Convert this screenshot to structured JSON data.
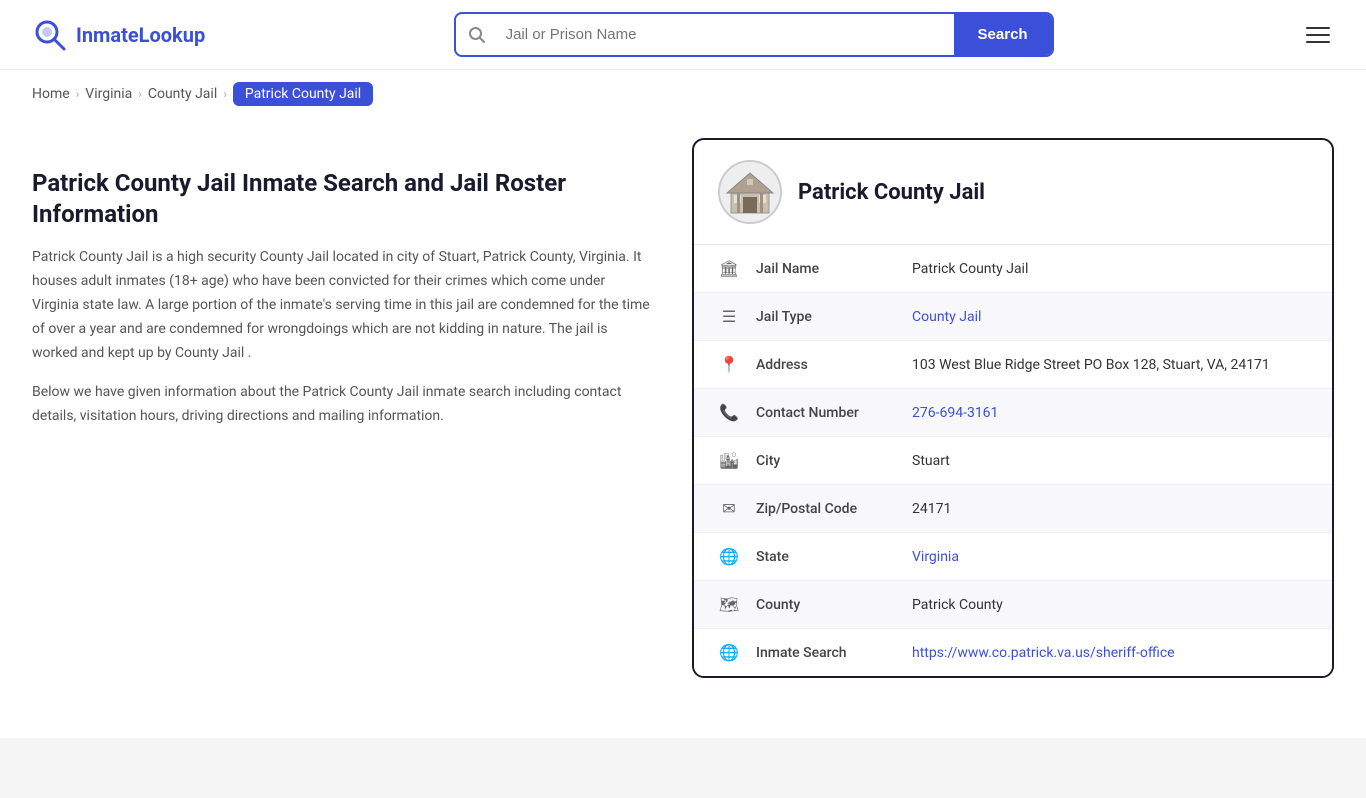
{
  "header": {
    "logo_text_main": "Inmate",
    "logo_text_accent": "Lookup",
    "search_placeholder": "Jail or Prison Name",
    "search_button_label": "Search"
  },
  "breadcrumb": {
    "items": [
      {
        "label": "Home",
        "href": "#"
      },
      {
        "label": "Virginia",
        "href": "#"
      },
      {
        "label": "County Jail",
        "href": "#"
      },
      {
        "label": "Patrick County Jail",
        "active": true
      }
    ]
  },
  "left": {
    "title": "Patrick County Jail Inmate Search and Jail Roster Information",
    "desc1": "Patrick County Jail is a high security County Jail located in city of Stuart, Patrick County, Virginia. It houses adult inmates (18+ age) who have been convicted for their crimes which come under Virginia state law. A large portion of the inmate's serving time in this jail are condemned for the time of over a year and are condemned for wrongdoings which are not kidding in nature. The jail is worked and kept up by County Jail .",
    "desc2": "Below we have given information about the Patrick County Jail inmate search including contact details, visitation hours, driving directions and mailing information."
  },
  "card": {
    "jail_name": "Patrick County Jail",
    "rows": [
      {
        "icon": "jail-icon",
        "label": "Jail Name",
        "value": "Patrick County Jail",
        "link": null
      },
      {
        "icon": "list-icon",
        "label": "Jail Type",
        "value": "County Jail",
        "link": "#"
      },
      {
        "icon": "location-icon",
        "label": "Address",
        "value": "103 West Blue Ridge Street PO Box 128, Stuart, VA, 24171",
        "link": null
      },
      {
        "icon": "phone-icon",
        "label": "Contact Number",
        "value": "276-694-3161",
        "link": "tel:276-694-3161"
      },
      {
        "icon": "city-icon",
        "label": "City",
        "value": "Stuart",
        "link": null
      },
      {
        "icon": "mail-icon",
        "label": "Zip/Postal Code",
        "value": "24171",
        "link": null
      },
      {
        "icon": "globe-icon",
        "label": "State",
        "value": "Virginia",
        "link": "#"
      },
      {
        "icon": "county-icon",
        "label": "County",
        "value": "Patrick County",
        "link": null
      },
      {
        "icon": "search-globe-icon",
        "label": "Inmate Search",
        "value": "https://www.co.patrick.va.us/sheriff-office",
        "link": "https://www.co.patrick.va.us/sheriff-office"
      }
    ]
  }
}
